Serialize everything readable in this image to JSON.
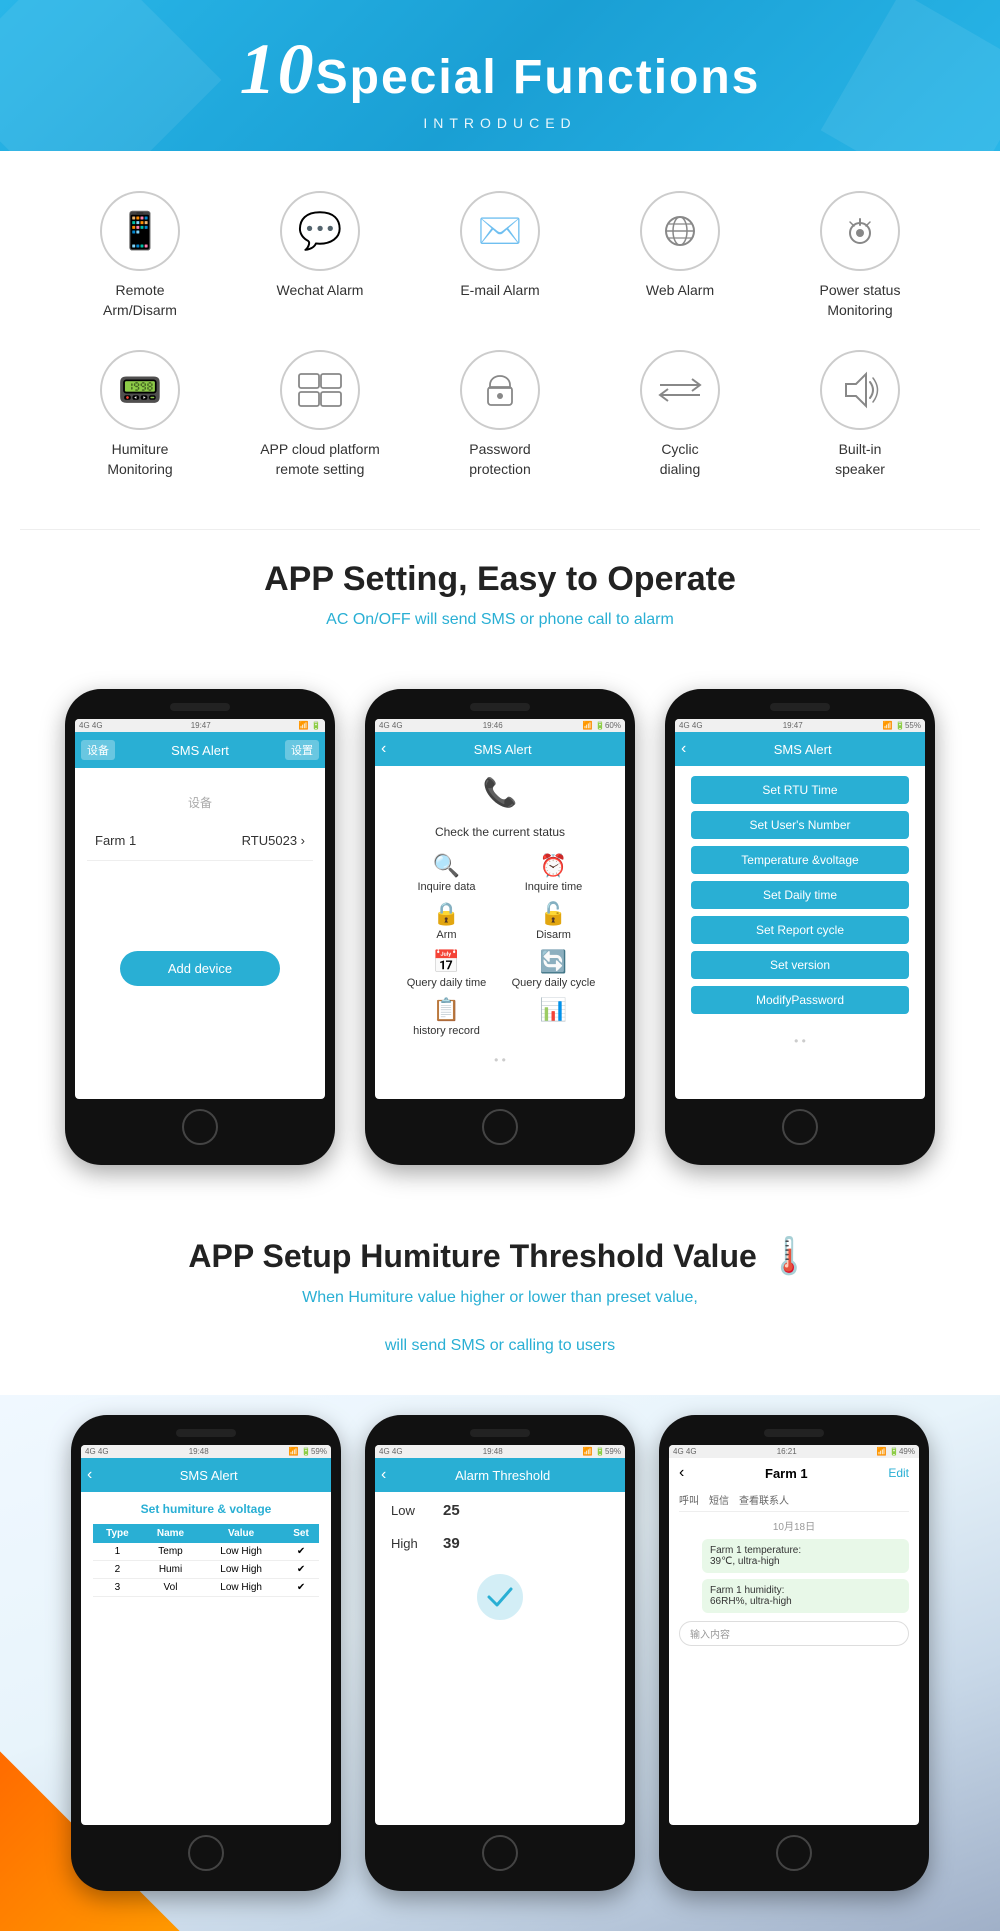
{
  "header": {
    "number": "10",
    "title": "Special Functions",
    "subtitle": "INTRODUCED"
  },
  "icons_row1": [
    {
      "id": "remote-arm",
      "icon": "📱",
      "label": "Remote\nArm/Disarm"
    },
    {
      "id": "wechat-alarm",
      "icon": "💬",
      "label": "Wechat Alarm"
    },
    {
      "id": "email-alarm",
      "icon": "✉️",
      "label": "E-mail Alarm"
    },
    {
      "id": "web-alarm",
      "icon": "⚙️",
      "label": "Web Alarm"
    },
    {
      "id": "power-status",
      "icon": "🔍",
      "label": "Power status\nMonitoring"
    }
  ],
  "icons_row2": [
    {
      "id": "humiture",
      "icon": "📟",
      "label": "Humiture\nMonitoring"
    },
    {
      "id": "app-cloud",
      "icon": "💻",
      "label": "APP cloud platform\nremote setting"
    },
    {
      "id": "password",
      "icon": "🤝",
      "label": "Password\nprotection"
    },
    {
      "id": "cyclic",
      "icon": "⇄",
      "label": "Cyclic\ndialing"
    },
    {
      "id": "builtin",
      "icon": "🔊",
      "label": "Built-in\nspeaker"
    }
  ],
  "app_section": {
    "title": "APP Setting, Easy to Operate",
    "subtitle": "AC On/OFF will send SMS or phone call to alarm"
  },
  "phone1": {
    "status_bar": "SMS Alert",
    "farm": "Farm 1",
    "rtu": "RTU5023",
    "add_device": "Add device"
  },
  "phone2": {
    "title": "SMS Alert",
    "check_status": "Check the current status",
    "items": [
      {
        "icon": "🔍",
        "label": "Inquire data"
      },
      {
        "icon": "⏰",
        "label": "Inquire time"
      },
      {
        "icon": "🔒",
        "label": "Arm"
      },
      {
        "icon": "🔓",
        "label": "Disarm"
      },
      {
        "icon": "📅",
        "label": "Query daily time"
      },
      {
        "icon": "📅",
        "label": "Query daily cycle"
      },
      {
        "icon": "📊",
        "label": "history record"
      },
      {
        "icon": "📈",
        "label": ""
      }
    ]
  },
  "phone3": {
    "title": "SMS Alert",
    "buttons": [
      "Set RTU Time",
      "Set User's Number",
      "Temperature &voltage",
      "Set Daily time",
      "Set Report cycle",
      "Set version",
      "ModifyPassword"
    ]
  },
  "humiture_section": {
    "title": "APP Setup Humiture Threshold Value",
    "subtitle1": "When Humiture value higher or lower than preset value,",
    "subtitle2": "will send SMS or calling to users"
  },
  "hphone1": {
    "title": "SMS Alert",
    "header_row": "Set humiture & voltage",
    "columns": [
      "Type",
      "Name",
      "Value",
      "Set"
    ],
    "rows": [
      [
        "1",
        "Temp",
        "Low",
        "High",
        "✓"
      ],
      [
        "2",
        "Humi",
        "Low",
        "High",
        "✓"
      ],
      [
        "3",
        "Vol",
        "Low",
        "High",
        "✓"
      ]
    ]
  },
  "hphone2": {
    "title": "Alarm Threshold",
    "low_label": "Low",
    "low_value": "25",
    "high_label": "High",
    "high_value": "39"
  },
  "hphone3": {
    "farm": "Farm 1",
    "edit": "Edit",
    "tabs": [
      "呼叫",
      "短信",
      "查看联系人"
    ],
    "date": "10月18日",
    "bubbles": [
      "Farm 1 temperature:\n39℃, ultra-high",
      "Farm 1 humidity:\n66RH%, ultra-high"
    ],
    "input_placeholder": "输入内容"
  }
}
